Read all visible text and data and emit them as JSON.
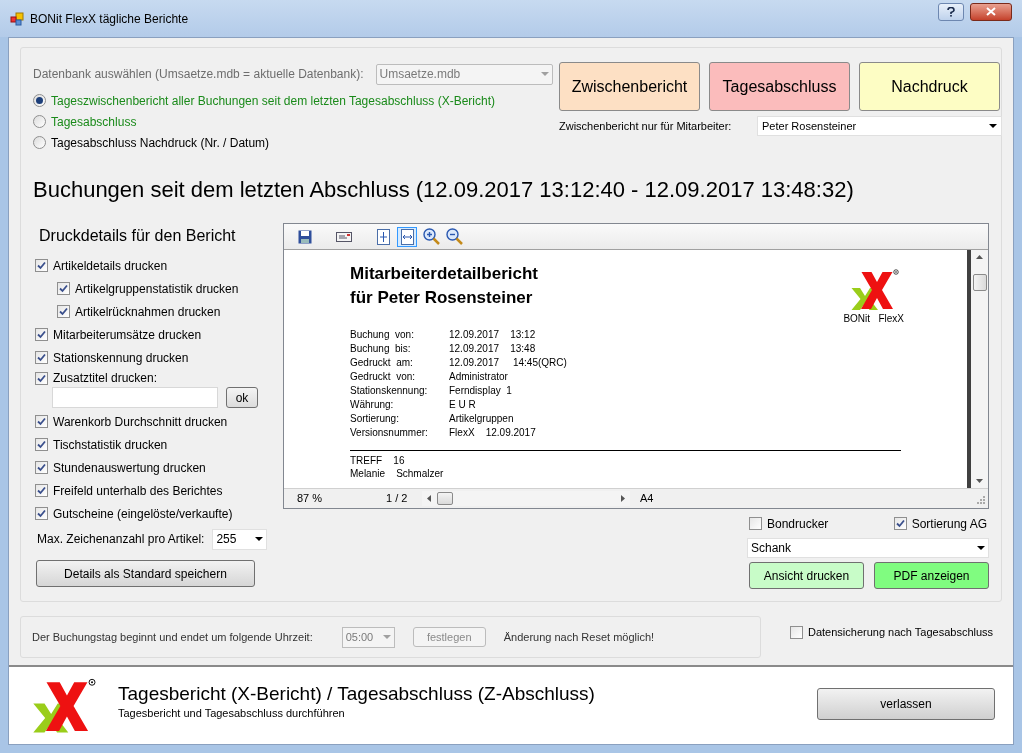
{
  "window": {
    "title": "BONit FlexX tägliche Berichte"
  },
  "database": {
    "label": "Datenbank auswählen (Umsaetze.mdb = aktuelle Datenbank):",
    "value": "Umsaetze.mdb",
    "disabled": true
  },
  "modes": [
    {
      "label": "Tageszwischenbericht aller Buchungen seit dem letzten Tagesabschluss (X-Bericht)",
      "selected": true,
      "color": "#1a8a1a"
    },
    {
      "label": "Tagesabschluss",
      "selected": false,
      "color": "#1a8a1a"
    },
    {
      "label": "Tagesabschluss Nachdruck (Nr. / Datum)",
      "selected": false,
      "color": "#000000"
    }
  ],
  "actions": [
    {
      "label": "Zwischenbericht",
      "color": "#fde0c4"
    },
    {
      "label": "Tagesabschluss",
      "color": "#fbbcbc"
    },
    {
      "label": "Nachdruck",
      "color": "#fdfdc4"
    }
  ],
  "employee_filter": {
    "label": "Zwischenbericht nur für Mitarbeiter:",
    "value": "Peter Rosensteiner"
  },
  "heading": "Buchungen seit dem letzten Abschluss (12.09.2017 13:12:40 - 12.09.2017 13:48:32)",
  "print_details": {
    "title": "Druckdetails für den Bericht",
    "options": [
      {
        "kind": "checkbox",
        "label": "Artikeldetails drucken",
        "checked": true,
        "children": [
          {
            "kind": "checkbox",
            "label": "Artikelgruppenstatistik drucken",
            "checked": true
          },
          {
            "kind": "checkbox",
            "label": "Artikelrücknahmen drucken",
            "checked": true
          }
        ]
      },
      {
        "kind": "checkbox",
        "label": "Mitarbeiterumsätze drucken",
        "checked": true
      },
      {
        "kind": "checkbox",
        "label": "Stationskennung drucken",
        "checked": true
      },
      {
        "kind": "text",
        "label": "Zusatztitel drucken:",
        "checked": true,
        "button": "ok"
      },
      {
        "kind": "checkbox",
        "label": "Warenkorb Durchschnitt drucken",
        "checked": true
      },
      {
        "kind": "checkbox",
        "label": "Tischstatistik drucken",
        "checked": true
      },
      {
        "kind": "checkbox",
        "label": "Stundenauswertung drucken",
        "checked": true
      },
      {
        "kind": "checkbox",
        "label": "Freifeld unterhalb des Berichtes",
        "checked": true
      },
      {
        "kind": "checkbox",
        "label": "Gutscheine (eingelöste/verkaufte)",
        "checked": true
      }
    ],
    "max_chars": {
      "label": "Max. Zeichenanzahl pro Artikel:",
      "value": "255"
    },
    "save_button": "Details als Standard speichern"
  },
  "preview": {
    "report": {
      "title_lines": [
        "Mitarbeiterdetailbericht",
        "für Peter Rosensteiner"
      ],
      "logo_caption": "BONit   FlexX",
      "fields": [
        {
          "label": "Buchung  von:",
          "value": "12.09.2017    13:12"
        },
        {
          "label": "Buchung  bis:",
          "value": "12.09.2017    13:48"
        },
        {
          "label": "Gedruckt  am:",
          "value": "12.09.2017     14:45(QRC)"
        },
        {
          "label": "Gedruckt  von:",
          "value": "Administrator"
        },
        {
          "label": "Stationskennung:",
          "value": "Ferndisplay  1"
        },
        {
          "label": "Währung:",
          "value": "E U R"
        },
        {
          "label": "Sortierung:",
          "value": "Artikelgruppen"
        },
        {
          "label": "Versionsnummer:",
          "value": "FlexX    12.09.2017"
        }
      ],
      "after_rule": [
        "TREFF    16",
        "Melanie    Schmalzer"
      ]
    },
    "status": {
      "zoom": "87 %",
      "page": "1 / 2",
      "paper": "A4"
    }
  },
  "output": {
    "options": [
      {
        "label": "Bondrucker",
        "checked": false
      },
      {
        "label": "Sortierung AG",
        "checked": true
      }
    ],
    "printer": "Schank",
    "buttons": [
      {
        "label": "Ansicht drucken",
        "color": "#c8fcc8"
      },
      {
        "label": "PDF anzeigen",
        "color": "#80fc80"
      }
    ]
  },
  "day_start": {
    "label": "Der Buchungstag beginnt und endet um folgende Uhrzeit:",
    "value": "05:00",
    "button": "festlegen",
    "note": "Änderung nach Reset möglich!",
    "disabled": true
  },
  "backup": {
    "label": "Datensicherung nach Tagesabschluss",
    "checked": false
  },
  "footer": {
    "title": "Tagesbericht (X-Bericht) / Tagesabschluss (Z-Abschluss)",
    "subtitle": "Tagesbericht und Tagesabschluss durchführen"
  },
  "exit_button": "verlassen"
}
